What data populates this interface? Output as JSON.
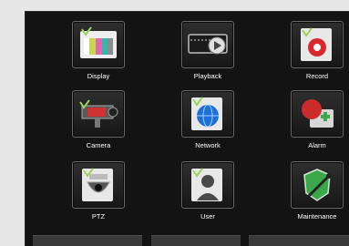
{
  "menu": {
    "items": [
      {
        "label": "Display",
        "icon": "display-icon"
      },
      {
        "label": "Playback",
        "icon": "playback-icon"
      },
      {
        "label": "Record",
        "icon": "record-icon"
      },
      {
        "label": "Camera",
        "icon": "camera-icon"
      },
      {
        "label": "Network",
        "icon": "network-icon"
      },
      {
        "label": "Alarm",
        "icon": "alarm-icon"
      },
      {
        "label": "PTZ",
        "icon": "ptz-icon"
      },
      {
        "label": "User",
        "icon": "user-icon"
      },
      {
        "label": "Maintenance",
        "icon": "maintenance-icon"
      }
    ]
  },
  "colors": {
    "screen_bg": "#131313",
    "page_bg": "#e7e7e7",
    "label": "#ffffff",
    "record_red": "#d8282e",
    "maintenance_green": "#3aa84a",
    "network_blue": "#1f6fd6"
  }
}
